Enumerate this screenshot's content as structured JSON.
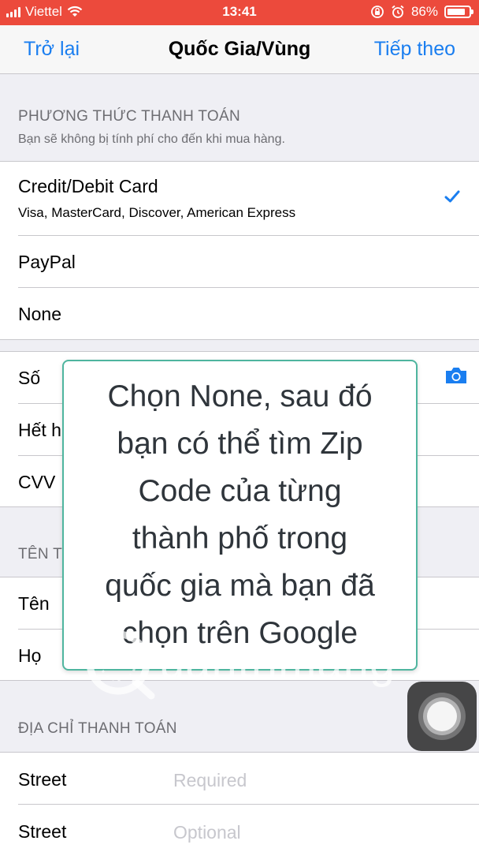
{
  "status_bar": {
    "carrier": "Viettel",
    "time": "13:41",
    "battery": "86%",
    "battery_level": 0.86
  },
  "nav": {
    "back": "Trở lại",
    "title": "Quốc Gia/Vùng",
    "next": "Tiếp theo"
  },
  "payment": {
    "header": "PHƯƠNG THỨC THANH TOÁN",
    "subheader": "Bạn sẽ không bị tính phí cho đến khi mua hàng.",
    "options": [
      {
        "label": "Credit/Debit Card",
        "detail": "Visa, MasterCard, Discover, American Express",
        "selected": true
      },
      {
        "label": "PayPal"
      },
      {
        "label": "None"
      }
    ]
  },
  "card": {
    "number_label": "Số",
    "expiry_label": "Hết h",
    "cvv_label": "CVV"
  },
  "name_section": {
    "header": "TÊN T",
    "first_name_label": "Tên",
    "last_name_label": "Họ"
  },
  "address": {
    "header": "ĐỊA CHỈ THANH TOÁN",
    "rows": [
      {
        "label": "Street",
        "placeholder": "Required"
      },
      {
        "label": "Street",
        "placeholder": "Optional"
      }
    ]
  },
  "overlay": {
    "lines": [
      "Chọn None, sau đó",
      "bạn có thể tìm Zip",
      "Code của từng",
      "thành phố trong",
      "quốc gia mà bạn đã",
      "chọn trên Google"
    ]
  },
  "watermark": {
    "text": "uantrimang"
  },
  "colors": {
    "status_bar": "#ec4a3c",
    "accent": "#1a7ef0",
    "tooltip_border": "#4fb59f"
  },
  "icons": {
    "checkmark": "checkmark-icon",
    "camera": "camera-icon",
    "assistive_touch": "assistive-touch-icon"
  }
}
